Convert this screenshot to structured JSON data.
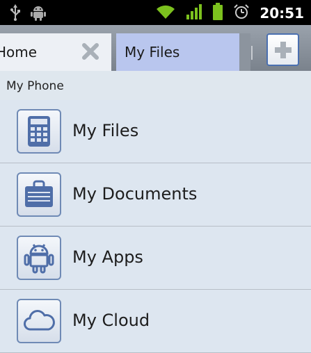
{
  "status_bar": {
    "time": "20:51",
    "left_icons": [
      "usb-icon",
      "android-debug-icon"
    ],
    "right_icons": [
      "wifi-icon",
      "signal-icon",
      "battery-icon",
      "alarm-icon"
    ],
    "accent": "#7cc11e"
  },
  "tabs": [
    {
      "label": "Home",
      "closable": true,
      "active": false
    },
    {
      "label": "My Files",
      "closable": false,
      "active": true
    }
  ],
  "add_tab_icon": "plus-icon",
  "section": {
    "label": "My Phone"
  },
  "items": [
    {
      "label": "My Files",
      "icon": "calculator-icon"
    },
    {
      "label": "My Documents",
      "icon": "briefcase-icon"
    },
    {
      "label": "My Apps",
      "icon": "android-icon"
    },
    {
      "label": "My Cloud",
      "icon": "cloud-icon"
    }
  ],
  "colors": {
    "tab_active": "#b9c6ee",
    "list_bg": "#dde6f0",
    "icon_blue": "#4f6ea8"
  }
}
